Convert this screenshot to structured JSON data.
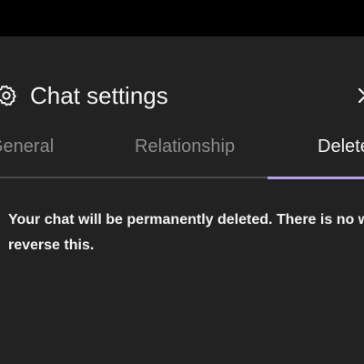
{
  "dialog": {
    "title": "Chat settings",
    "header_icon": "gear-icon",
    "close_icon": "close-icon"
  },
  "tabs": [
    {
      "label": "General",
      "active": false
    },
    {
      "label": "Relationship",
      "active": false
    },
    {
      "label": "Delete",
      "active": true
    }
  ],
  "content": {
    "message": "Your chat will be permanently deleted. There is no way to reverse this."
  },
  "colors": {
    "background": "#000000",
    "panel": "#222222",
    "text_primary": "#f2f2f2",
    "text_muted": "#8c8c8c",
    "divider": "#4a4a4a",
    "accent": "#b79ef0"
  }
}
